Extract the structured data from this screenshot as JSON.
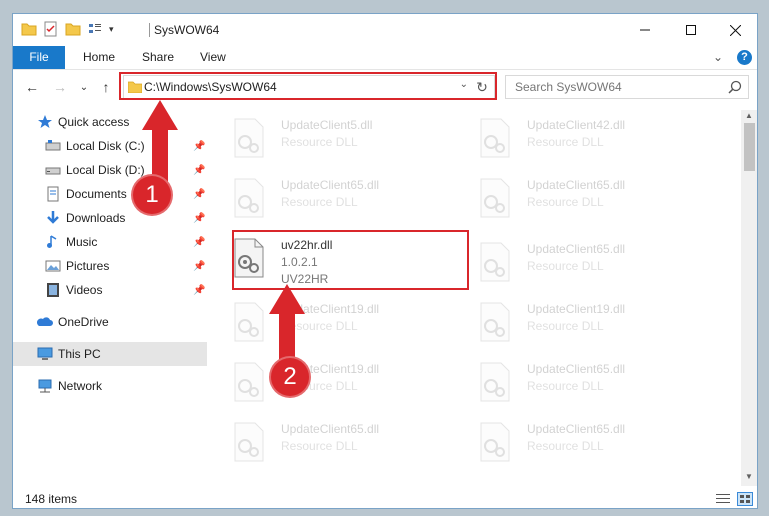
{
  "window": {
    "title": "SysWOW64",
    "minimize_label": "—",
    "maximize_label": "☐",
    "close_label": "✕"
  },
  "ribbon": {
    "tabs": [
      "File",
      "Home",
      "Share",
      "View"
    ],
    "expand_label": "⌄",
    "help_label": "?"
  },
  "nav": {
    "back": "←",
    "forward": "→",
    "recent": "⌄",
    "up": "↑"
  },
  "address": {
    "path": "C:\\Windows\\SysWOW64",
    "dropdown": "⌄",
    "refresh": "↻"
  },
  "search": {
    "placeholder": "Search SysWOW64"
  },
  "sidebar": {
    "items": [
      {
        "label": "Quick access",
        "icon": "star-icon"
      },
      {
        "label": "Local Disk (C:)",
        "icon": "drive-icon",
        "pinned": true
      },
      {
        "label": "Local Disk (D:)",
        "icon": "drive-icon",
        "pinned": true
      },
      {
        "label": "Documents",
        "icon": "documents-icon",
        "pinned": true
      },
      {
        "label": "Downloads",
        "icon": "downloads-icon",
        "pinned": true
      },
      {
        "label": "Music",
        "icon": "music-icon",
        "pinned": true
      },
      {
        "label": "Pictures",
        "icon": "pictures-icon",
        "pinned": true
      },
      {
        "label": "Videos",
        "icon": "videos-icon",
        "pinned": true
      },
      {
        "label": "OneDrive",
        "icon": "onedrive-icon"
      },
      {
        "label": "This PC",
        "icon": "pc-icon",
        "selected": true
      },
      {
        "label": "Network",
        "icon": "network-icon"
      }
    ],
    "pin_glyph": "📌"
  },
  "files": {
    "left_column": [
      {
        "name": "UpdateClient5.dll",
        "desc": "Resource DLL"
      },
      {
        "name": "UpdateClient65.dll",
        "desc": "Resource DLL"
      },
      {
        "name": "uv22hr.dll",
        "desc": "1.0.2.1",
        "desc2": "UV22HR",
        "highlighted": true
      },
      {
        "name": "UpdateClient19.dll",
        "desc": "Resource DLL"
      },
      {
        "name": "UpdateClient19.dll",
        "desc": "Resource DLL"
      },
      {
        "name": "UpdateClient65.dll",
        "desc": "Resource DLL"
      }
    ],
    "right_column": [
      {
        "name": "UpdateClient42.dll",
        "desc": "Resource DLL"
      },
      {
        "name": "UpdateClient65.dll",
        "desc": "Resource DLL"
      },
      {
        "name": "UpdateClient65.dll",
        "desc": "Resource DLL"
      },
      {
        "name": "UpdateClient19.dll",
        "desc": "Resource DLL"
      },
      {
        "name": "UpdateClient65.dll",
        "desc": "Resource DLL"
      },
      {
        "name": "UpdateClient65.dll",
        "desc": "Resource DLL"
      }
    ]
  },
  "status": {
    "item_count": "148 items"
  },
  "annotations": {
    "step1": "1",
    "step2": "2",
    "color": "#d9262b"
  }
}
